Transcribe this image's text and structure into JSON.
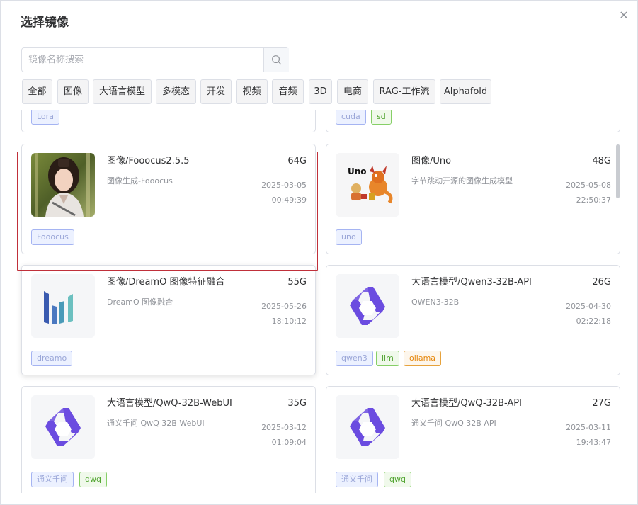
{
  "dialog": {
    "title": "选择镜像",
    "close_icon": "close-icon"
  },
  "search": {
    "placeholder": "镜像名称搜索",
    "value": "",
    "icon": "search-icon"
  },
  "filters": [
    "全部",
    "图像",
    "大语言模型",
    "多模态",
    "开发",
    "视频",
    "音频",
    "3D",
    "电商",
    "RAG-工作流",
    "Alphafold"
  ],
  "partial_cards": [
    {
      "tags": [
        {
          "label": "Lora",
          "color": "blue"
        }
      ]
    },
    {
      "tags": [
        {
          "label": "cuda",
          "color": "blue"
        },
        {
          "label": "sd",
          "color": "green"
        }
      ]
    }
  ],
  "cards": [
    {
      "name": "图像/Fooocus2.5.5",
      "size": "64G",
      "desc": "图像生成-Fooocus",
      "date": "2025-03-05",
      "time": "00:49:39",
      "thumb": "portrait-photo",
      "tags": [
        {
          "label": "Fooocus",
          "color": "blue"
        }
      ]
    },
    {
      "name": "图像/Uno",
      "size": "48G",
      "desc": "字节跳动开源的图像生成模型",
      "date": "2025-05-08",
      "time": "22:50:37",
      "thumb": "uno-dragon-logo",
      "thumb_text": "Uno",
      "tags": [
        {
          "label": "uno",
          "color": "blue"
        }
      ]
    },
    {
      "name": "图像/DreamO 图像特征融合",
      "size": "55G",
      "desc": "DreamO 图像融合",
      "date": "2025-05-26",
      "time": "18:10:12",
      "thumb": "dreamo-bars-logo",
      "selected": true,
      "tags": [
        {
          "label": "dreamo",
          "color": "blue"
        }
      ]
    },
    {
      "name": "大语言模型/Qwen3-32B-API",
      "size": "26G",
      "desc": "QWEN3-32B",
      "date": "2025-04-30",
      "time": "02:22:18",
      "thumb": "qwen-logo",
      "tags": [
        {
          "label": "qwen3",
          "color": "blue"
        },
        {
          "label": "llm",
          "color": "green"
        },
        {
          "label": "ollama",
          "color": "orange"
        }
      ]
    },
    {
      "name": "大语言模型/QwQ-32B-WebUI",
      "size": "35G",
      "desc": "通义千问 QwQ 32B WebUI",
      "date": "2025-03-12",
      "time": "01:09:04",
      "thumb": "qwen-logo",
      "tags": [
        {
          "label": "通义千问",
          "color": "blue"
        },
        {
          "label": "qwq",
          "color": "green"
        }
      ]
    },
    {
      "name": "大语言模型/QwQ-32B-API",
      "size": "27G",
      "desc": "通义千问 QwQ 32B API",
      "date": "2025-03-11",
      "time": "19:43:47",
      "thumb": "qwen-logo",
      "tags": [
        {
          "label": "通义千问",
          "color": "blue"
        },
        {
          "label": "qwq",
          "color": "green"
        }
      ]
    }
  ],
  "colors": {
    "tag_blue": "#a5b4f2",
    "tag_green": "#86cf67",
    "tag_orange": "#e6a23c",
    "qwen_purple": "#6b4ce0",
    "selection_outline": "#c0303a"
  }
}
